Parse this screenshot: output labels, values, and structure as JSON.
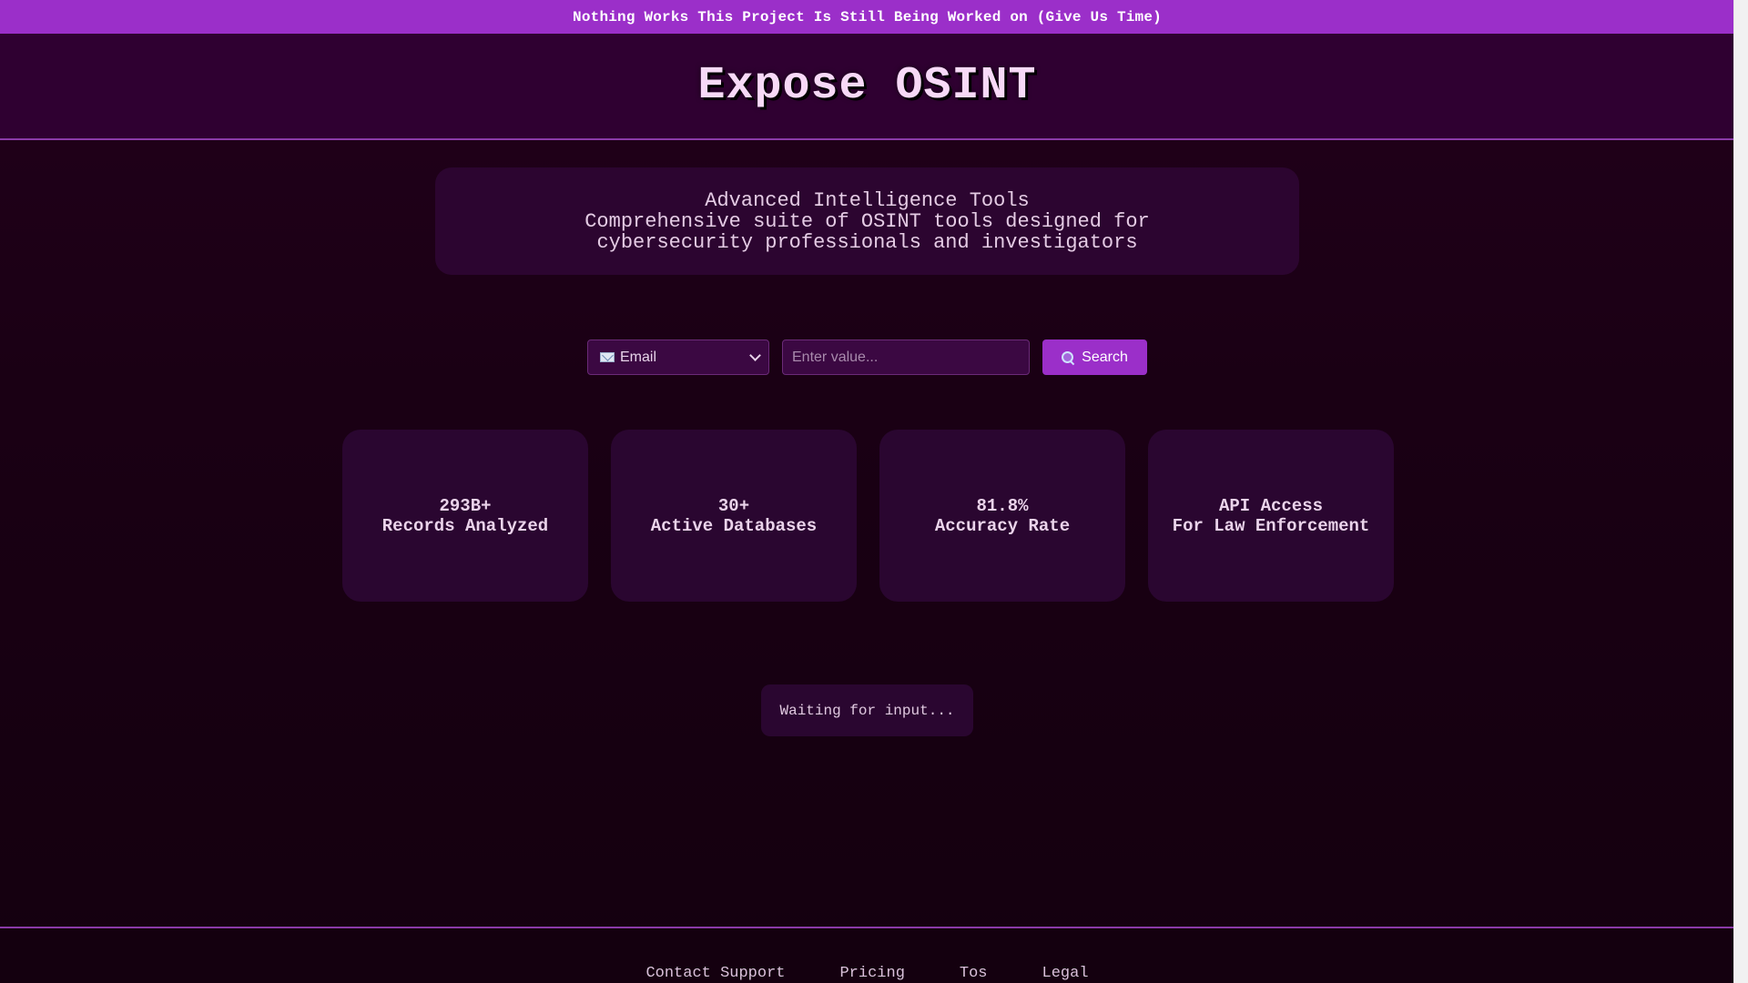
{
  "banner": {
    "text": "Nothing Works This Project Is Still Being Worked on (Give Us Time)"
  },
  "header": {
    "title": "Expose OSINT"
  },
  "hero": {
    "title": "Advanced Intelligence Tools",
    "subtitle": "Comprehensive suite of OSINT tools designed for cybersecurity professionals and investigators"
  },
  "search": {
    "type_selected": "Email",
    "type_icon": "envelope-icon",
    "placeholder": "Enter value...",
    "button_label": "Search",
    "button_icon": "search-icon"
  },
  "stats": [
    {
      "value": "293B+",
      "label": "Records Analyzed"
    },
    {
      "value": "30+",
      "label": "Active Databases"
    },
    {
      "value": "81.8%",
      "label": "Accuracy Rate"
    },
    {
      "value": "API Access",
      "label": "For Law Enforcement"
    }
  ],
  "status": {
    "text": "Waiting for input..."
  },
  "footer": {
    "links": [
      "Contact Support",
      "Pricing",
      "Tos",
      "Legal"
    ]
  },
  "colors": {
    "accent": "#9b2fc9",
    "header_bg": "#2f0031",
    "card_bg": "#2a0630",
    "page_bg": "#14000f"
  }
}
